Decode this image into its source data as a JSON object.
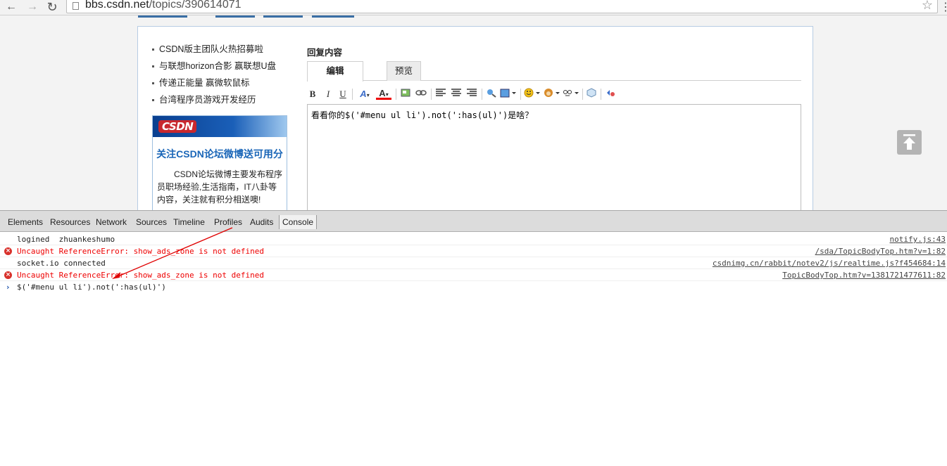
{
  "browser": {
    "url_host": "bbs.csdn.net",
    "url_path": "/topics/390614071",
    "back_icon": "back-arrow",
    "forward_icon": "forward-arrow",
    "reload_icon": "reload",
    "bookmark_icon": "star"
  },
  "page": {
    "side_links": [
      "CSDN版主团队火热招募啦",
      "与联想horizon合影 赢联想U盘",
      "传递正能量 赢微软鼠标",
      "台湾程序员游戏开发经历"
    ],
    "promo": {
      "logo": "CSDN",
      "title": "关注CSDN论坛微博送可用分",
      "body": "CSDN论坛微博主要发布程序员职场经验,生活指南，IT八卦等内容，关注就有积分相送噢!"
    },
    "reply": {
      "title": "回复内容",
      "tab_edit": "编辑",
      "tab_preview": "预览",
      "toolbar": {
        "bold": "B",
        "italic": "I",
        "underline": "U",
        "font": "A",
        "color": "A"
      },
      "editor_text": "看看你的$('#menu ul li').not(':has(ul)')是啥？"
    }
  },
  "devtools": {
    "tabs": [
      "Elements",
      "Resources",
      "Network",
      "Sources",
      "Timeline",
      "Profiles",
      "Audits",
      "Console"
    ],
    "active_tab": "Console",
    "logs": [
      {
        "type": "log",
        "message": "logined  zhuankeshumo",
        "source": "notify.js:43"
      },
      {
        "type": "error",
        "message": "Uncaught ReferenceError: show_ads_zone is not defined",
        "source": "/sda/TopicBodyTop.htm?v=1:82"
      },
      {
        "type": "log",
        "message": "socket.io connected",
        "source": "csdnimg.cn/rabbit/notev2/js/realtime.js?f454684:14"
      },
      {
        "type": "error",
        "message": "Uncaught ReferenceError: show_ads_zone is not defined",
        "source": "TopicBodyTop.htm?v=1381721477611:82"
      }
    ],
    "prompt_input": "$('#menu ul li').not(':has(ul)')",
    "error_color": "#e00000",
    "annotation_arrow_color": "#e00000"
  }
}
